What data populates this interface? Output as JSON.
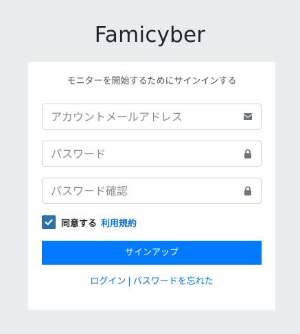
{
  "app": {
    "brand_title": "Famicyber"
  },
  "form": {
    "subtitle": "モニターを開始するためにサインインする",
    "email": {
      "placeholder": "アカウントメールアドレス",
      "value": "",
      "icon": "envelope-icon"
    },
    "password": {
      "placeholder": "パスワード",
      "value": "",
      "icon": "lock-icon"
    },
    "password_confirm": {
      "placeholder": "パスワード確認",
      "value": "",
      "icon": "lock-icon"
    },
    "agree": {
      "checked": true,
      "label": "同意する",
      "terms_link": "利用規約"
    },
    "submit_label": "サインアップ",
    "links": {
      "login": "ログイン",
      "separator": "|",
      "forgot": "パスワードを忘れた"
    }
  },
  "colors": {
    "background": "#e9ecef",
    "primary": "#007bff",
    "checkbox": "#2f6fac",
    "link": "#0b6fd8"
  }
}
